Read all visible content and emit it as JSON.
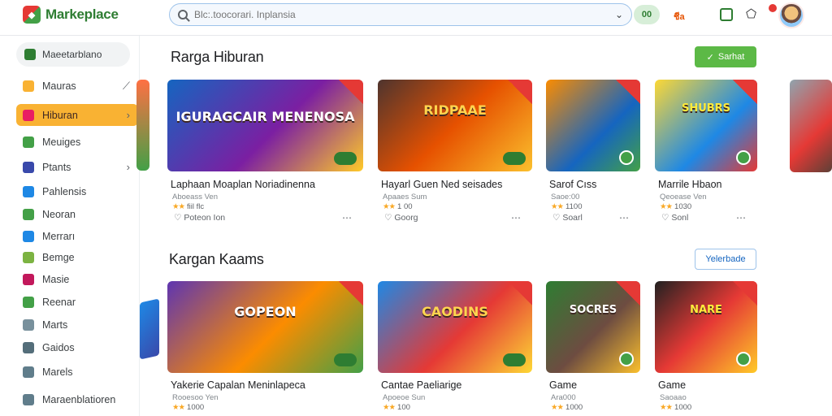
{
  "app": {
    "name": "Markeplace",
    "logo_glyph": "◆"
  },
  "search": {
    "placeholder": "Blc:.toocorari. Inplansia",
    "button_label": "00"
  },
  "topbar": {
    "lang": "ชีa",
    "bell_glyph": "⬠"
  },
  "sidebar": {
    "top_item": "Maeetarblano",
    "items": [
      {
        "label": "Mauras",
        "color": "#f9b233",
        "trailing": "⟋"
      },
      {
        "label": "Hiburan",
        "color": "#e91e63",
        "active": true,
        "trailing": "›"
      },
      {
        "label": "Meuiges",
        "color": "#43a047"
      },
      {
        "label": "Ptants",
        "color": "#3949ab",
        "trailing": "›"
      },
      {
        "label": "Pahlensis",
        "color": "#1e88e5"
      },
      {
        "label": "Neoran",
        "color": "#43a047"
      },
      {
        "label": "Merrarı",
        "color": "#1e88e5"
      },
      {
        "label": "Bemge",
        "color": "#7cb342"
      },
      {
        "label": "Masie",
        "color": "#c2185b"
      },
      {
        "label": "Reenar",
        "color": "#43a047"
      },
      {
        "label": "Marts",
        "color": "#78909c"
      },
      {
        "label": "Gaidos",
        "color": "#546e7a"
      },
      {
        "label": "Marels",
        "color": "#607d8b"
      },
      {
        "label": "Maraenblatioren",
        "color": "#607d8b"
      }
    ]
  },
  "sections": [
    {
      "title": "Rarga Hiburan",
      "button_label": "Sarhat",
      "cards": [
        {
          "title": "Laphaan Moaplan Noriadinenna",
          "sub": "Aboeass Ven",
          "rating": "fiil flc",
          "foot": "Poteon Ion",
          "art": "IGURAGCAIR MENENOSA"
        },
        {
          "title": "Hayarl Guen Ned seisades",
          "sub": "Apaaes Sum",
          "rating": "1 00",
          "foot": "Goorg",
          "art": "RIDPAAE"
        },
        {
          "title": "Sarof Cıss",
          "sub": "Saoe:00",
          "rating": "1100",
          "foot": "Soarl",
          "art": ""
        },
        {
          "title": "Marrile Hbaon",
          "sub": "Qeoease Ven",
          "rating": "1030",
          "foot": "Sonl",
          "art": "SHUBRS"
        }
      ]
    },
    {
      "title": "Kargan Kaams",
      "button_label": "Yelerbade",
      "cards": [
        {
          "title": "Yakerie Capalan Meninlapeca",
          "sub": "Rooesoo Yen",
          "rating": "1000",
          "art": "GOPEON"
        },
        {
          "title": "Cantae Paeliarige",
          "sub": "Apoeoe Sun",
          "rating": "100",
          "art": "CAODINS"
        },
        {
          "title": "Game",
          "sub": "Ara000",
          "rating": "1000",
          "art": "SOCRES"
        },
        {
          "title": "Game",
          "sub": "Saoaao",
          "rating": "1000",
          "art": "NARE"
        }
      ]
    }
  ]
}
